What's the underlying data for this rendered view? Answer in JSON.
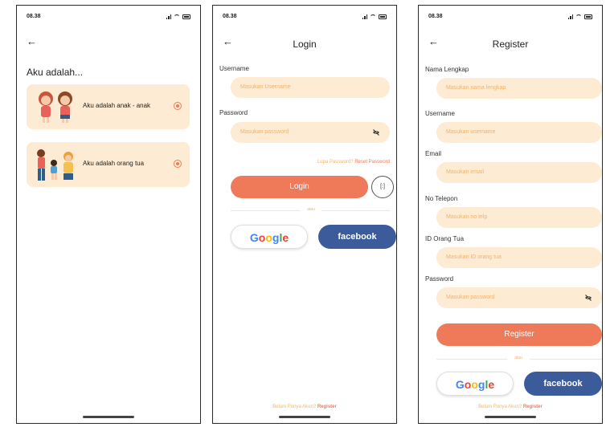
{
  "status": {
    "time": "08.38"
  },
  "role_screen": {
    "heading": "Aku adalah...",
    "options": [
      {
        "label": "Aku adalah anak - anak",
        "icon": "children-illustration-icon",
        "selected": true
      },
      {
        "label": "Aku adalah orang tua",
        "icon": "family-illustration-icon",
        "selected": true
      }
    ]
  },
  "login_screen": {
    "title": "Login",
    "username_label": "Username",
    "username_placeholder": "Masukan Username",
    "password_label": "Password",
    "password_placeholder": "Masukan password",
    "forgot_text": "Lupa Password?",
    "reset_text": "Reset Password",
    "login_button": "Login",
    "face_id_icon": "face-scan-icon",
    "divider_text": "atau",
    "google_label": "Google",
    "facebook_label": "facebook",
    "no_account_text": "Belum Punya Akun?",
    "register_link": "Register"
  },
  "register_screen": {
    "title": "Register",
    "fields": [
      {
        "label": "Nama Lengkap",
        "placeholder": "Masukan nama lengkap"
      },
      {
        "label": "Username",
        "placeholder": "Masukan username"
      },
      {
        "label": "Email",
        "placeholder": "Masukan email"
      },
      {
        "label": "No Telepon",
        "placeholder": "Masukan no telp"
      },
      {
        "label": "ID Orang Tua",
        "placeholder": "Masukan ID orang tua"
      },
      {
        "label": "Password",
        "placeholder": "Masukan password"
      }
    ],
    "register_button": "Register",
    "divider_text": "atau",
    "google_label": "Google",
    "facebook_label": "facebook",
    "no_account_text": "Belum Punya Akun?",
    "register_link": "Register"
  },
  "colors": {
    "accent": "#ef7a5a",
    "field_bg": "#fdebd3",
    "placeholder": "#f3b46a",
    "facebook": "#3b5b9a"
  }
}
